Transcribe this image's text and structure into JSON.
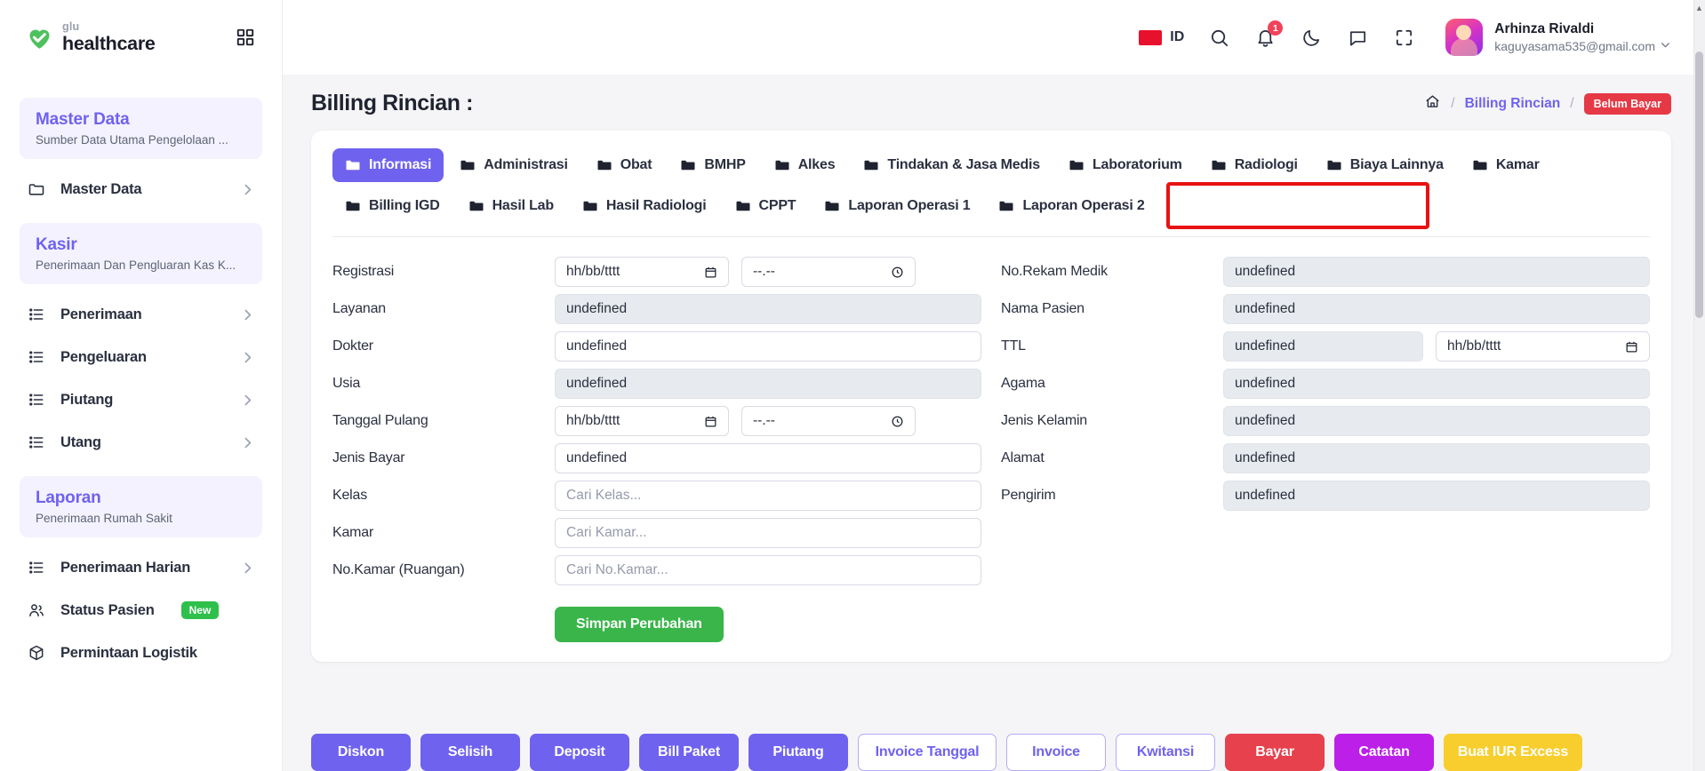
{
  "brand": {
    "small": "glu",
    "name": "healthcare",
    "grid_icon": "grid-icon"
  },
  "sidebar": {
    "sections": [
      {
        "title": "Master Data",
        "subtitle": "Sumber Data Utama Pengelolaan ..."
      },
      {
        "title": "Kasir",
        "subtitle": "Penerimaan Dan Pengluaran Kas K..."
      },
      {
        "title": "Laporan",
        "subtitle": "Penerimaan Rumah Sakit"
      }
    ],
    "items_master": [
      {
        "label": "Master Data",
        "icon": "folder-icon",
        "caret": true
      }
    ],
    "items_kasir": [
      {
        "label": "Penerimaan",
        "icon": "list-icon",
        "caret": true
      },
      {
        "label": "Pengeluaran",
        "icon": "list-icon",
        "caret": true
      },
      {
        "label": "Piutang",
        "icon": "list-icon",
        "caret": true
      },
      {
        "label": "Utang",
        "icon": "list-icon",
        "caret": true
      }
    ],
    "items_laporan": [
      {
        "label": "Penerimaan Harian",
        "icon": "list-icon",
        "caret": true
      },
      {
        "label": "Status Pasien",
        "icon": "users-icon",
        "caret": false,
        "badge": "New"
      },
      {
        "label": "Permintaan Logistik",
        "icon": "box-icon",
        "caret": false
      }
    ]
  },
  "topbar": {
    "lang_code": "ID",
    "flag_color": "#e8112d",
    "notification_count": "1",
    "user_name": "Arhinza Rivaldi",
    "user_email": "kaguyasama535@gmail.com",
    "icons": [
      "search-icon",
      "bell-icon",
      "moon-icon",
      "chat-icon",
      "fullscreen-icon"
    ]
  },
  "page": {
    "title": "Billing Rincian :",
    "breadcrumb": {
      "home": "home-icon",
      "sep": "/",
      "link": "Billing Rincian",
      "badge": "Belum Bayar",
      "badge_color": "#e63946"
    }
  },
  "tabs": [
    {
      "label": "Informasi",
      "active": true
    },
    {
      "label": "Administrasi",
      "active": false
    },
    {
      "label": "Obat",
      "active": false
    },
    {
      "label": "BMHP",
      "active": false
    },
    {
      "label": "Alkes",
      "active": false
    },
    {
      "label": "Tindakan & Jasa Medis",
      "active": false
    },
    {
      "label": "Laboratorium",
      "active": false
    },
    {
      "label": "Radiologi",
      "active": false
    },
    {
      "label": "Biaya Lainnya",
      "active": false
    },
    {
      "label": "Kamar",
      "active": false
    },
    {
      "label": "Billing IGD",
      "active": false
    },
    {
      "label": "Hasil Lab",
      "active": false
    },
    {
      "label": "Hasil Radiologi",
      "active": false
    },
    {
      "label": "CPPT",
      "active": false
    },
    {
      "label": "Laporan Operasi 1",
      "active": false
    },
    {
      "label": "Laporan Operasi 2",
      "active": false
    }
  ],
  "form": {
    "left": [
      {
        "label": "Registrasi",
        "type": "date-time",
        "date_placeholder": "hh/bb/tttt",
        "time_placeholder": "--.--"
      },
      {
        "label": "Layanan",
        "type": "text",
        "value": "undefined",
        "disabled": true
      },
      {
        "label": "Dokter",
        "type": "text",
        "value": "undefined",
        "disabled": false
      },
      {
        "label": "Usia",
        "type": "text",
        "value": "undefined",
        "disabled": true
      },
      {
        "label": "Tanggal Pulang",
        "type": "date-time",
        "date_placeholder": "hh/bb/tttt",
        "time_placeholder": "--.--"
      },
      {
        "label": "Jenis Bayar",
        "type": "text",
        "value": "undefined",
        "disabled": false
      },
      {
        "label": "Kelas",
        "type": "search",
        "placeholder": "Cari Kelas...",
        "disabled": false
      },
      {
        "label": "Kamar",
        "type": "search",
        "placeholder": "Cari Kamar...",
        "disabled": false
      },
      {
        "label": "No.Kamar (Ruangan)",
        "type": "search",
        "placeholder": "Cari No.Kamar...",
        "disabled": false
      }
    ],
    "right": [
      {
        "label": "No.Rekam Medik",
        "type": "text",
        "value": "undefined",
        "disabled": true
      },
      {
        "label": "Nama Pasien",
        "type": "text",
        "value": "undefined",
        "disabled": true
      },
      {
        "label": "TTL",
        "type": "text-date",
        "value": "undefined",
        "disabled": true,
        "date_placeholder": "hh/bb/tttt"
      },
      {
        "label": "Agama",
        "type": "text",
        "value": "undefined",
        "disabled": true
      },
      {
        "label": "Jenis Kelamin",
        "type": "text",
        "value": "undefined",
        "disabled": true
      },
      {
        "label": "Alamat",
        "type": "text",
        "value": "undefined",
        "disabled": true
      },
      {
        "label": "Pengirim",
        "type": "text",
        "value": "undefined",
        "disabled": true
      }
    ],
    "save_label": "Simpan Perubahan"
  },
  "footer_buttons": [
    {
      "label": "Diskon",
      "style": "solid-purple"
    },
    {
      "label": "Selisih",
      "style": "solid-purple"
    },
    {
      "label": "Deposit",
      "style": "solid-purple"
    },
    {
      "label": "Bill Paket",
      "style": "solid-purple"
    },
    {
      "label": "Piutang",
      "style": "solid-purple"
    },
    {
      "label": "Invoice Tanggal",
      "style": "outline-purple",
      "wide": true
    },
    {
      "label": "Invoice",
      "style": "outline-purple"
    },
    {
      "label": "Kwitansi",
      "style": "outline-purple"
    },
    {
      "label": "Bayar",
      "style": "red"
    },
    {
      "label": "Catatan",
      "style": "magenta"
    },
    {
      "label": "Buat IUR Excess",
      "style": "yellow",
      "wide": true
    }
  ],
  "colors": {
    "accent": "#6f62ef",
    "green": "#39b54a",
    "red": "#e6414c",
    "magenta": "#bb1fe8",
    "yellow": "#f7ce2e",
    "highlight_box": "#e81111"
  }
}
